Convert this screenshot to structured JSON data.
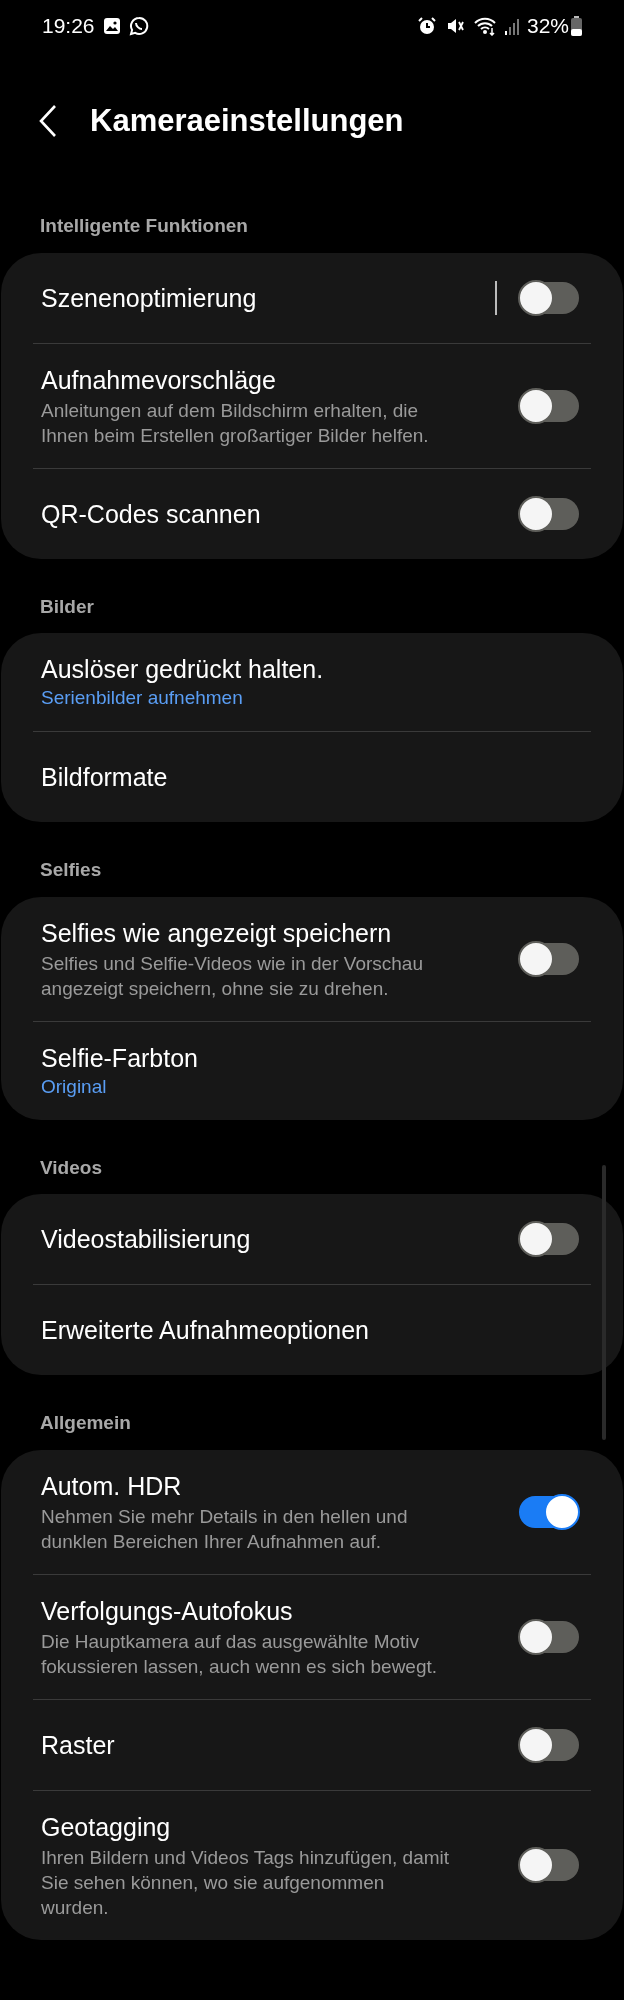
{
  "status_bar": {
    "time": "19:26",
    "battery": "32%"
  },
  "header": {
    "title": "Kameraeinstellungen"
  },
  "sections": [
    {
      "label": "Intelligente Funktionen",
      "items": [
        {
          "kind": "toggle",
          "title": "Szenenoptimierung",
          "on": false,
          "split": true
        },
        {
          "kind": "toggle",
          "title": "Aufnahmevorschläge",
          "subtitle": "Anleitungen auf dem Bildschirm erhalten, die Ihnen beim Erstellen großartiger Bilder helfen.",
          "on": false
        },
        {
          "kind": "toggle",
          "title": "QR-Codes scannen",
          "on": false
        }
      ]
    },
    {
      "label": "Bilder",
      "items": [
        {
          "kind": "link",
          "title": "Auslöser gedrückt halten.",
          "value": "Serienbilder aufnehmen"
        },
        {
          "kind": "link",
          "title": "Bildformate"
        }
      ]
    },
    {
      "label": "Selfies",
      "items": [
        {
          "kind": "toggle",
          "title": "Selfies wie angezeigt speichern",
          "subtitle": "Selfies und Selfie-Videos wie in der Vorschau angezeigt speichern, ohne sie zu drehen.",
          "on": false
        },
        {
          "kind": "link",
          "title": "Selfie-Farbton",
          "value": "Original"
        }
      ]
    },
    {
      "label": "Videos",
      "items": [
        {
          "kind": "toggle",
          "title": "Videostabilisierung",
          "on": false
        },
        {
          "kind": "link",
          "title": "Erweiterte Aufnahmeoptionen"
        }
      ]
    },
    {
      "label": "Allgemein",
      "items": [
        {
          "kind": "toggle",
          "title": "Autom. HDR",
          "subtitle": "Nehmen Sie mehr Details in den hellen und dunklen Bereichen Ihrer Aufnahmen auf.",
          "on": true
        },
        {
          "kind": "toggle",
          "title": "Verfolgungs-Autofokus",
          "subtitle": "Die Hauptkamera auf das ausgewählte Motiv fokussieren lassen, auch wenn es sich bewegt.",
          "on": false
        },
        {
          "kind": "toggle",
          "title": "Raster",
          "on": false
        },
        {
          "kind": "toggle",
          "title": "Geotagging",
          "subtitle": "Ihren Bildern und Videos Tags hinzufügen, damit Sie sehen können, wo sie aufgenommen wurden.",
          "on": false
        }
      ]
    }
  ]
}
